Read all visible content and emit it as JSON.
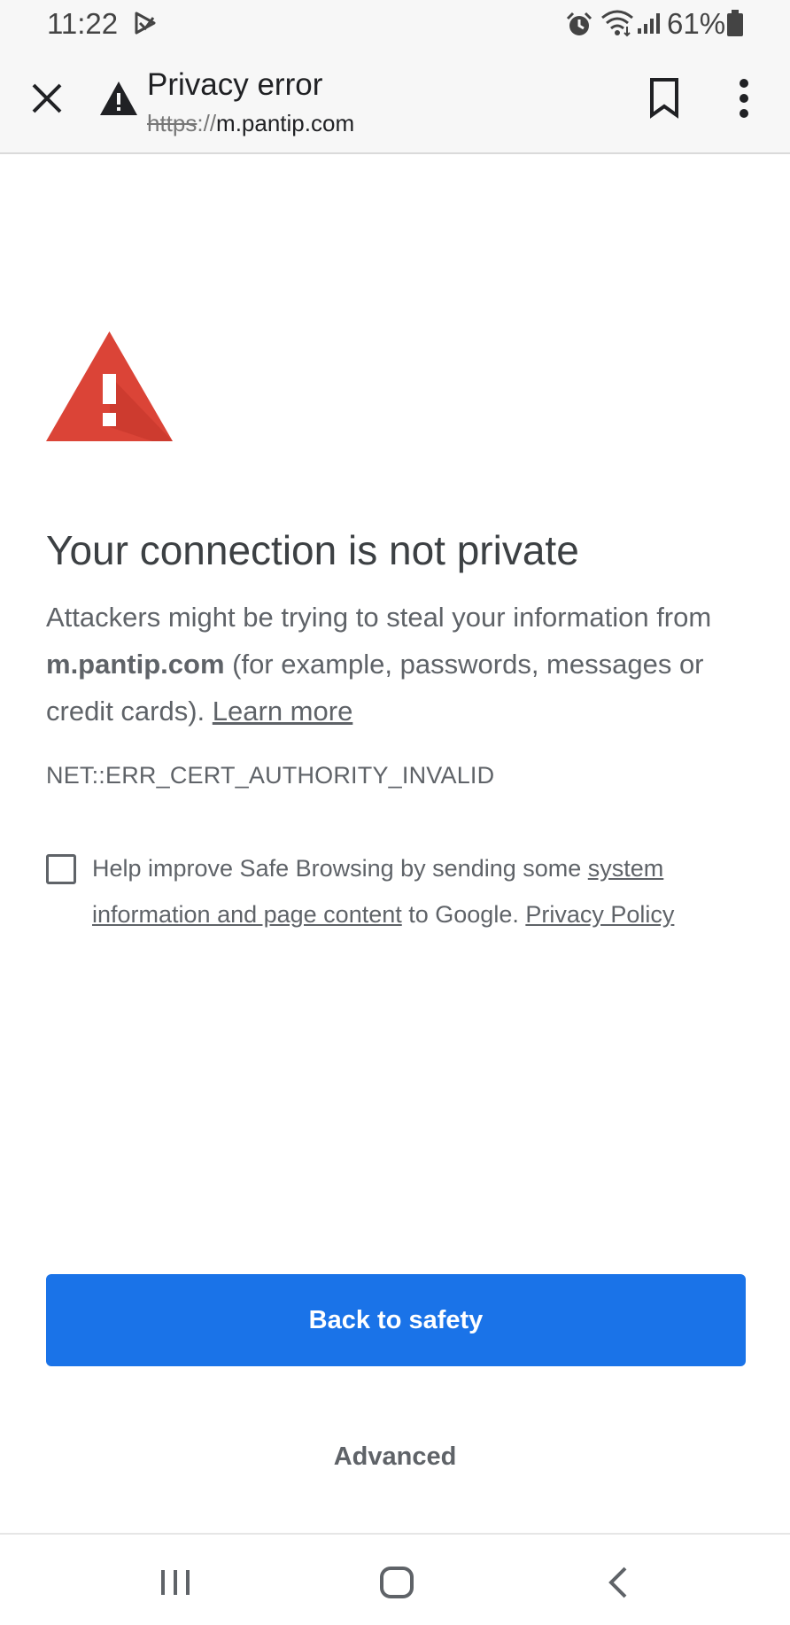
{
  "status_bar": {
    "time": "11:22",
    "battery_percent": "61%",
    "icons": [
      "play-store-notification-icon",
      "alarm-icon",
      "wifi-icon",
      "signal-icon",
      "battery-icon"
    ]
  },
  "toolbar": {
    "title": "Privacy error",
    "url_scheme": "https",
    "url_separator": "://",
    "url_host": "m.pantip.com",
    "icons": [
      "close-icon",
      "warning-icon",
      "bookmark-icon",
      "more-vert-icon"
    ]
  },
  "interstitial": {
    "heading": "Your connection is not private",
    "body_prefix": "Attackers might be trying to steal your information from ",
    "body_domain": "m.pantip.com",
    "body_suffix": " (for example, passwords, messages or credit cards). ",
    "learn_more": "Learn more",
    "error_code": "NET::ERR_CERT_AUTHORITY_INVALID",
    "checkbox_checked": false,
    "checkbox_text_prefix": "Help improve Safe Browsing by sending some ",
    "checkbox_link_system_info": "system information and page content",
    "checkbox_text_middle": " to Google. ",
    "checkbox_link_privacy": "Privacy Policy",
    "primary_button": "Back to safety",
    "secondary_button": "Advanced"
  },
  "nav_bar": {
    "icons": [
      "recents-icon",
      "home-icon",
      "back-icon"
    ]
  },
  "colors": {
    "accent": "#1a73e8",
    "warning_red": "#db4437",
    "text_primary": "#3c4043",
    "text_secondary": "#5f6368",
    "toolbar_bg": "#f7f7f7"
  }
}
